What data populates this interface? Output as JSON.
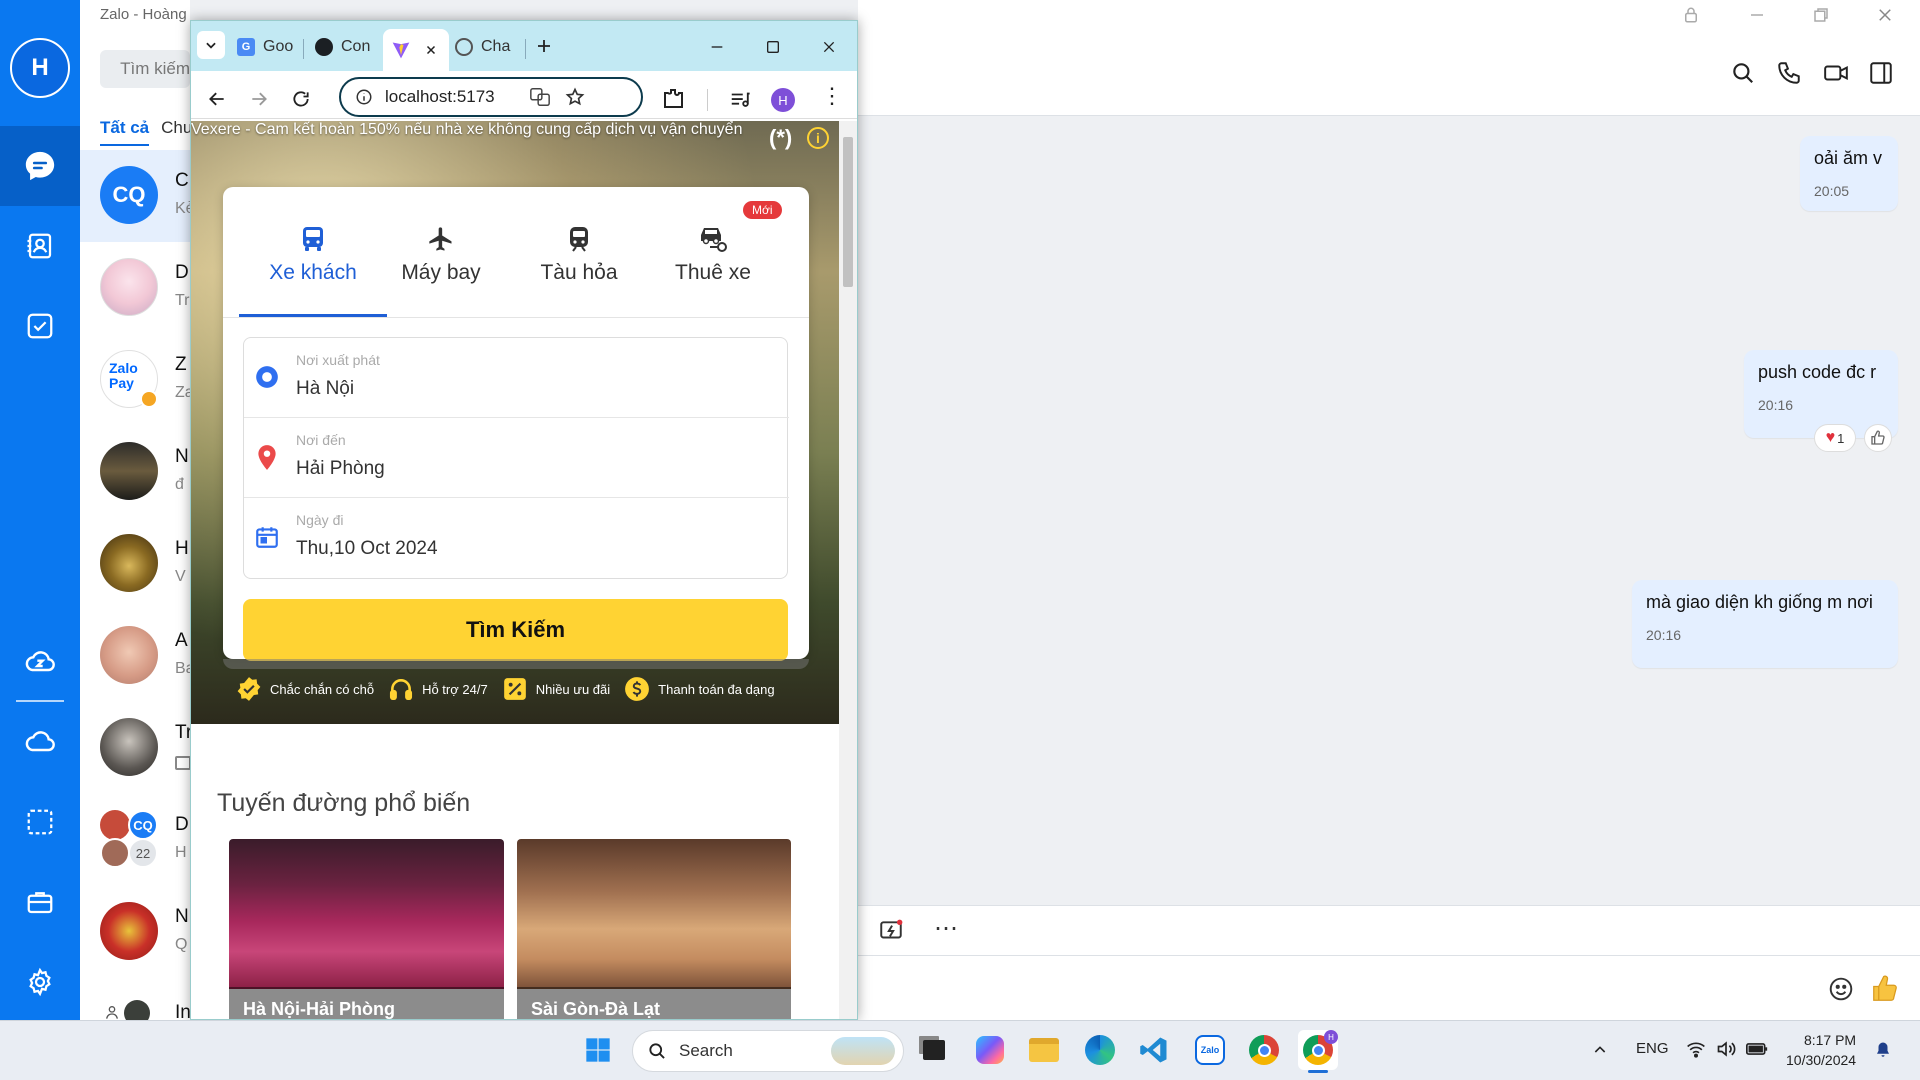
{
  "zalo": {
    "window_title": "Zalo - Hoàng",
    "avatar_initial": "H",
    "search_placeholder": "Tìm kiếm",
    "filter_tabs": {
      "all": "Tất cả",
      "unread": "Chưa đọc"
    },
    "conversations": [
      {
        "initial_title": "C",
        "snippet": "Kẻ"
      },
      {
        "initial_title": "D",
        "snippet": "Tr"
      },
      {
        "initial_title": "Z",
        "snippet": "Za"
      },
      {
        "initial_title": "N",
        "snippet": "đ"
      },
      {
        "initial_title": "H",
        "snippet": "V"
      },
      {
        "initial_title": "A",
        "snippet": "Ba"
      },
      {
        "initial_title": "Tr",
        "snippet": ""
      },
      {
        "initial_title": "D",
        "snippet": "H"
      },
      {
        "initial_title": "N",
        "snippet": "Q"
      },
      {
        "initial_title": "In",
        "snippet": ""
      }
    ],
    "cq_avatar_text": "CQ",
    "group_member_count": "22",
    "zalopay_text": "Zalo Pay",
    "messages": [
      {
        "text": "oải ăm v",
        "time": "20:05"
      },
      {
        "text": "push code đc r",
        "time": "20:16",
        "reaction_count": "1"
      },
      {
        "text": "mà giao diện kh giống m nơi",
        "time": "20:16"
      }
    ]
  },
  "browser": {
    "tabs": [
      {
        "label": "Goo",
        "icon": "google-translate-icon"
      },
      {
        "label": "Con",
        "icon": "github-icon"
      },
      {
        "label": "",
        "icon": "vite-icon",
        "active": true
      },
      {
        "label": "Cha",
        "icon": "chatgpt-icon"
      }
    ],
    "url": "localhost:5173",
    "profile_initial": "H"
  },
  "site": {
    "hero_note": "Vexere - Cam kết hoàn 150% nếu nhà xe không cung cấp dịch vụ vận chuyển",
    "hero_tag": "(*)",
    "modes": [
      {
        "label": "Xe khách",
        "icon": "bus-icon"
      },
      {
        "label": "Máy bay",
        "icon": "airplane-icon"
      },
      {
        "label": "Tàu hỏa",
        "icon": "train-icon"
      },
      {
        "label": "Thuê xe",
        "icon": "car-rental-icon",
        "badge": "Mới"
      }
    ],
    "form": {
      "from_label": "Nơi xuất phát",
      "from_value": "Hà Nội",
      "to_label": "Nơi đến",
      "to_value": "Hải Phòng",
      "date_label": "Ngày đi",
      "date_value": "Thu,10 Oct 2024"
    },
    "search_button": "Tìm Kiếm",
    "features": [
      "Chắc chắn có chỗ",
      "Hỗ trợ 24/7",
      "Nhiều ưu đãi",
      "Thanh toán đa dạng"
    ],
    "popular_title": "Tuyến đường phổ biến",
    "routes": [
      "Hà Nội-Hải Phòng",
      "Sài Gòn-Đà Lạt"
    ]
  },
  "taskbar": {
    "search_label": "Search",
    "lang": "ENG",
    "time": "8:17 PM",
    "date": "10/30/2024",
    "apps": [
      "windows-start-icon",
      "task-view-icon",
      "copilot-icon",
      "file-explorer-icon",
      "edge-icon",
      "vscode-icon",
      "zalo-icon",
      "chrome-icon",
      "chrome-profile-icon"
    ]
  },
  "colors": {
    "zalo_blue": "#0a78f0",
    "vexere_blue": "#1f5fd6",
    "vexere_yellow": "#ffd333",
    "message_bubble": "#e4efff"
  }
}
